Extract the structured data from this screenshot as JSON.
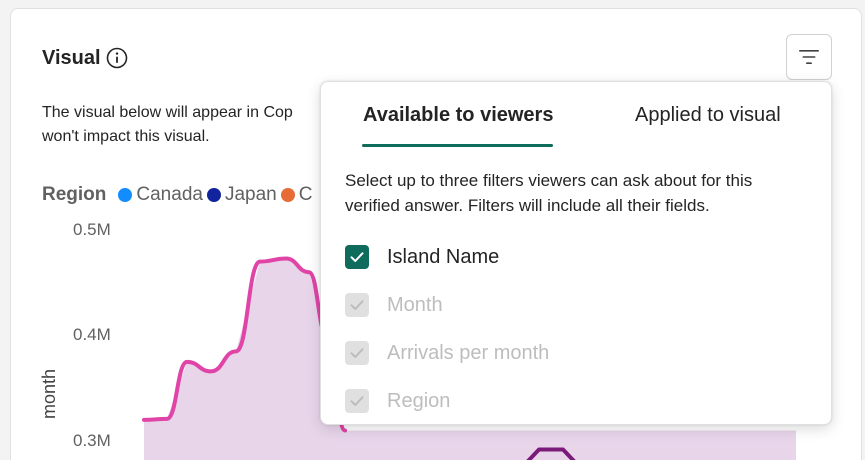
{
  "card": {
    "title": "Visual",
    "description_line1": "The visual below will appear in Cop",
    "description_line2": "won't impact this visual."
  },
  "legend": {
    "title": "Region",
    "items": [
      {
        "label": "Canada",
        "color": "#118dff"
      },
      {
        "label": "Japan",
        "color": "#12239e"
      },
      {
        "label": "C",
        "color": "#e66c37"
      }
    ]
  },
  "chart_data": {
    "type": "area",
    "ylabel": "month",
    "yticks": [
      "0.5M",
      "0.4M",
      "0.3M"
    ],
    "ylim": [
      0.28,
      0.5
    ],
    "series": [
      {
        "color": "#e044a7",
        "fill": "#e8d5ea",
        "values": [
          0.32,
          0.321,
          0.375,
          0.366,
          0.385,
          0.47,
          0.473,
          0.46,
          0.4,
          0.31
        ]
      },
      {
        "color": "#744ec2",
        "values": [
          0.28,
          0.292,
          0.292,
          0.28
        ]
      }
    ]
  },
  "filter_popup": {
    "tabs": [
      "Available to viewers",
      "Applied to visual"
    ],
    "active_tab": 0,
    "description": "Select up to three filters viewers can ask about for this verified answer. Filters will include all their fields.",
    "options": [
      {
        "label": "Island Name",
        "checked": true,
        "disabled": false
      },
      {
        "label": "Month",
        "checked": true,
        "disabled": true
      },
      {
        "label": "Arrivals per month",
        "checked": true,
        "disabled": true
      },
      {
        "label": "Region",
        "checked": true,
        "disabled": true
      }
    ]
  },
  "colors": {
    "accent": "#0f6b5c",
    "line": "#e044a7",
    "area": "#e8d5ea",
    "series2": "#7a1b7a"
  },
  "icons": {
    "info": "info-circle-icon",
    "filter": "filter-lines-icon",
    "check": "checkmark-icon"
  }
}
